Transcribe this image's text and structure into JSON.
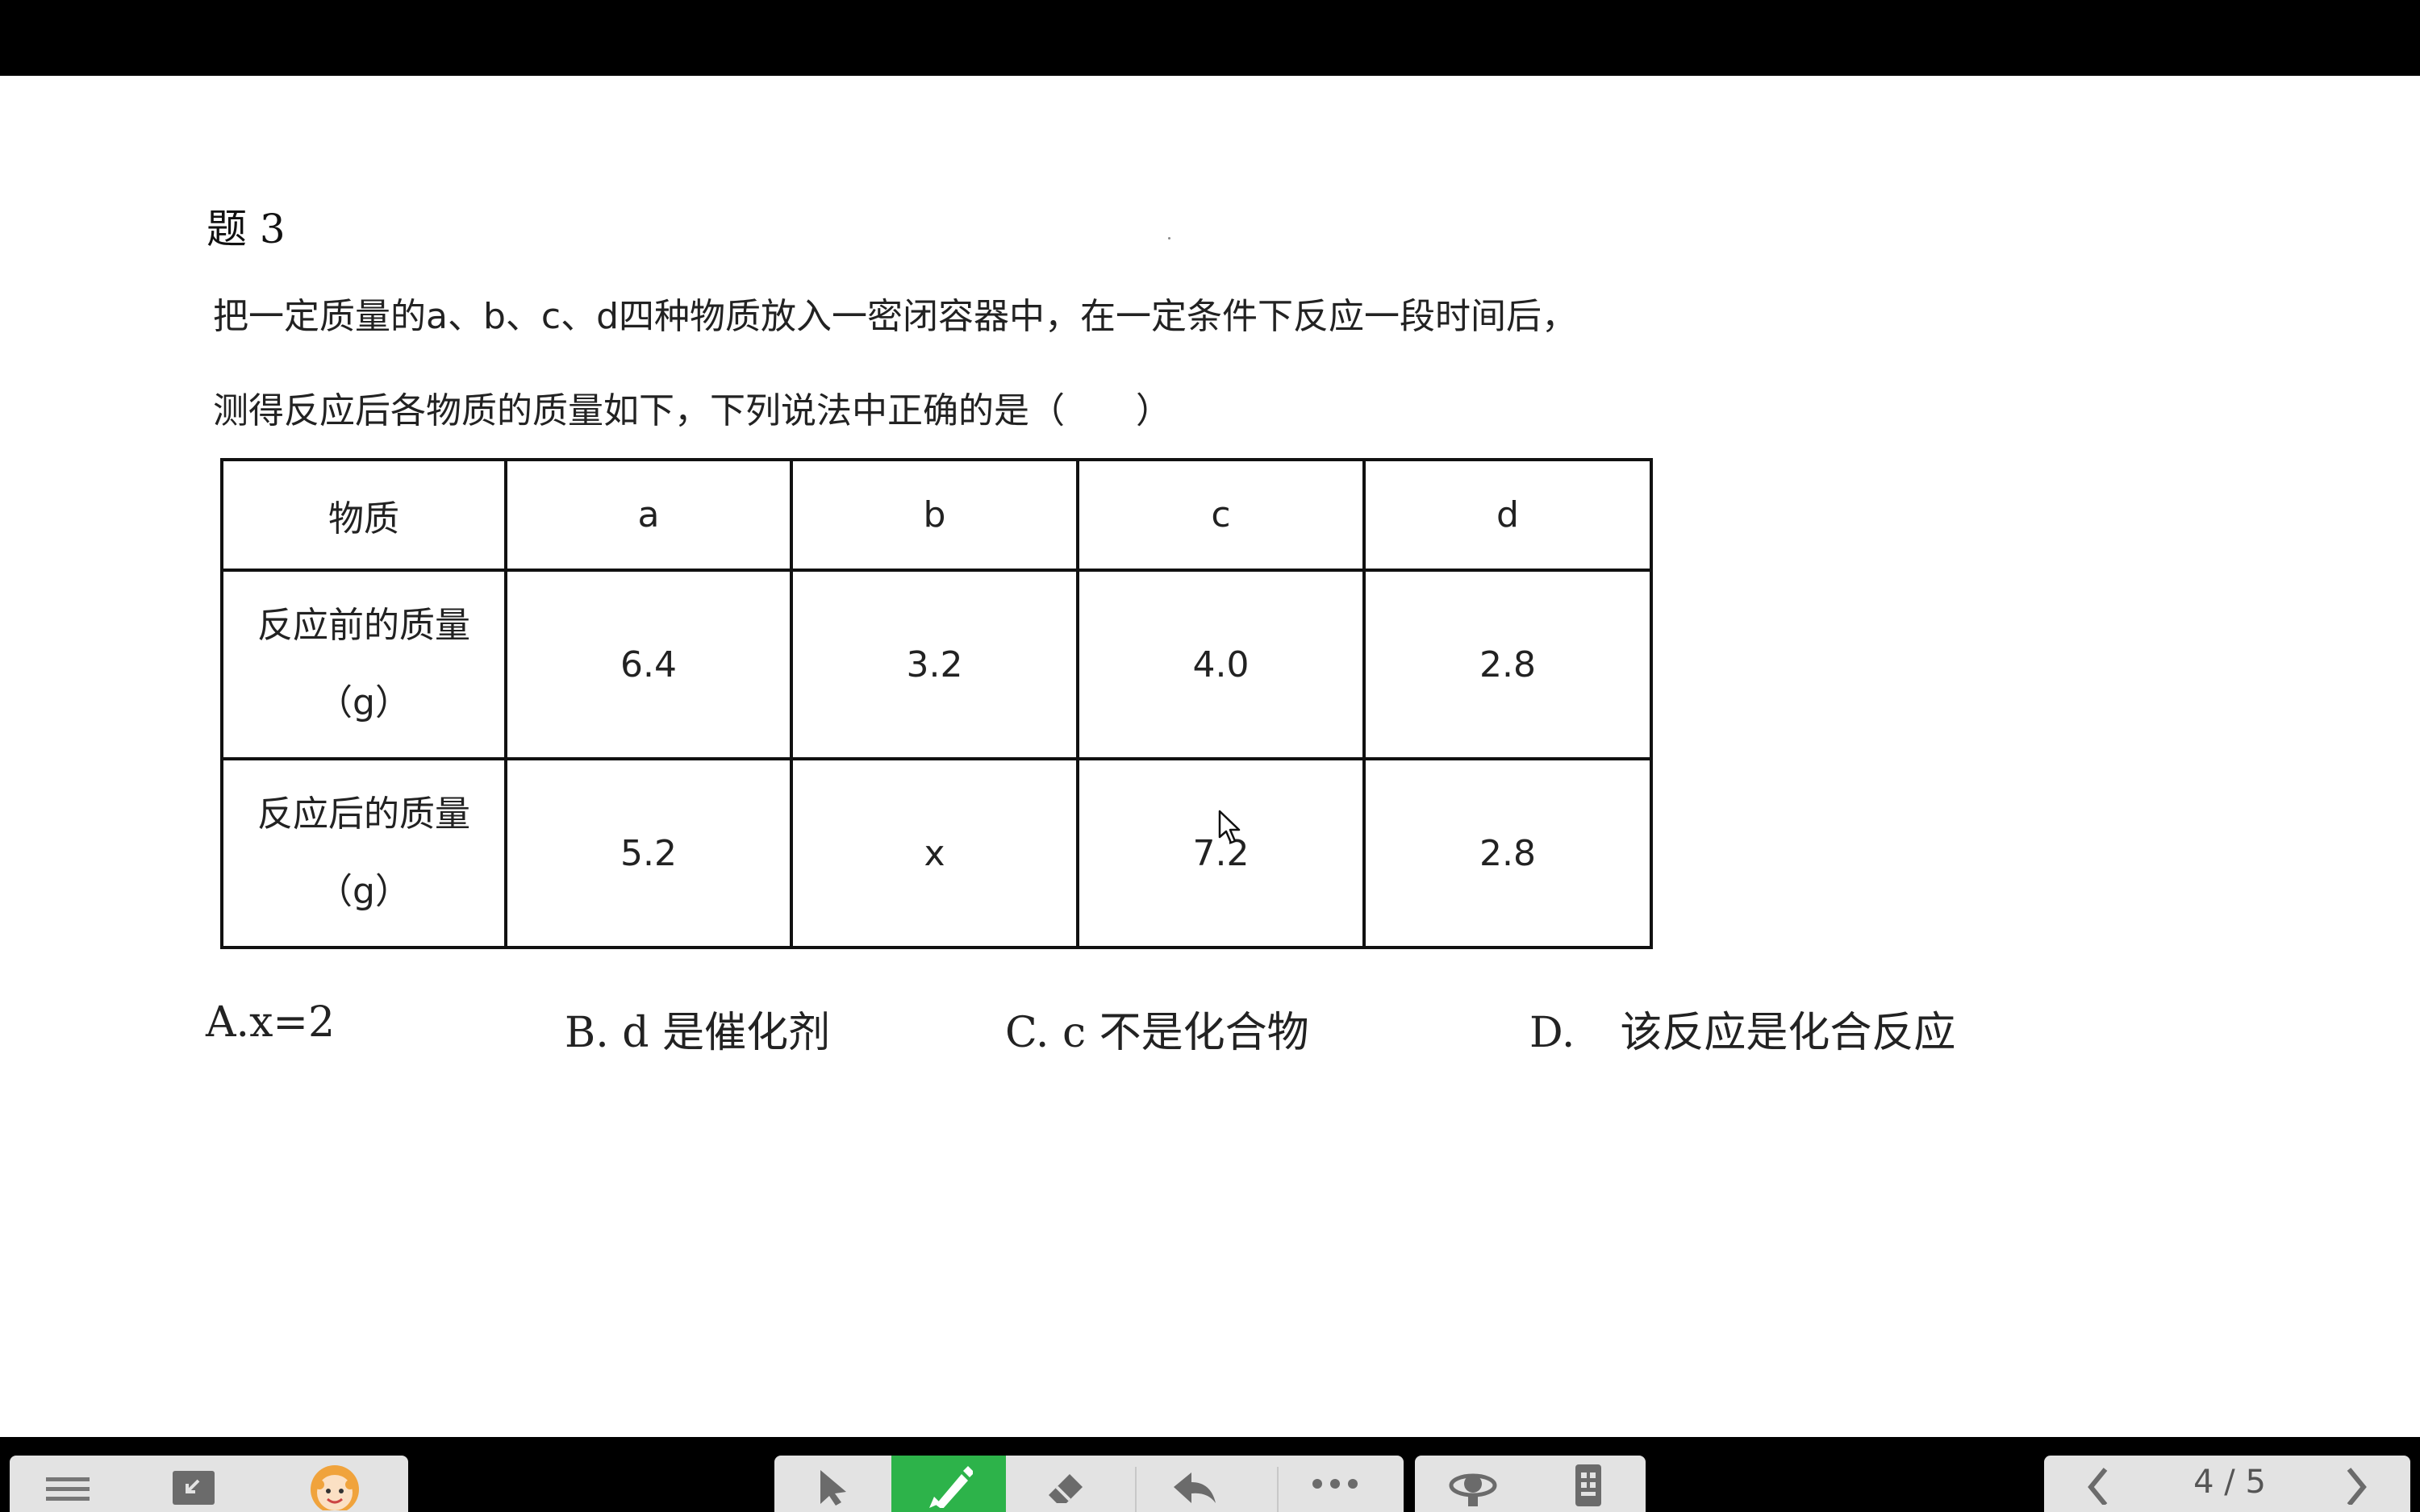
{
  "slide": {
    "title": "题 3",
    "question_line1": "把一定质量的a、b、c、d四种物质放入一密闭容器中，在一定条件下反应一段时间后，",
    "question_line2": "测得反应后各物质的质量如下，下列说法中正确的是（　　）",
    "table": {
      "header": [
        "物质",
        "a",
        "b",
        "c",
        "d"
      ],
      "rows": [
        {
          "label_line1": "反应前的质量",
          "label_line2": "（g）",
          "values": [
            "6.4",
            "3.2",
            "4.0",
            "2.8"
          ]
        },
        {
          "label_line1": "反应后的质量",
          "label_line2": "（g）",
          "values": [
            "5.2",
            "x",
            "7.2",
            "2.8"
          ]
        }
      ]
    },
    "options": {
      "a": "A.x=2",
      "b": "B. d 是催化剂",
      "c": "C. c 不是化合物",
      "d_letter": "D.",
      "d_text": "该反应是化合反应"
    }
  },
  "toolbar": {
    "left_group": [
      "menu-icon",
      "minimize-icon",
      "avatar"
    ],
    "center_group": [
      "pointer-icon",
      "pen-icon",
      "eraser-icon",
      "undo-icon",
      "more-icon"
    ],
    "right_group": [
      "broadcast-icon",
      "remote-icon"
    ],
    "page_indicator": "4 / 5",
    "accent_color": "#2db34a"
  }
}
